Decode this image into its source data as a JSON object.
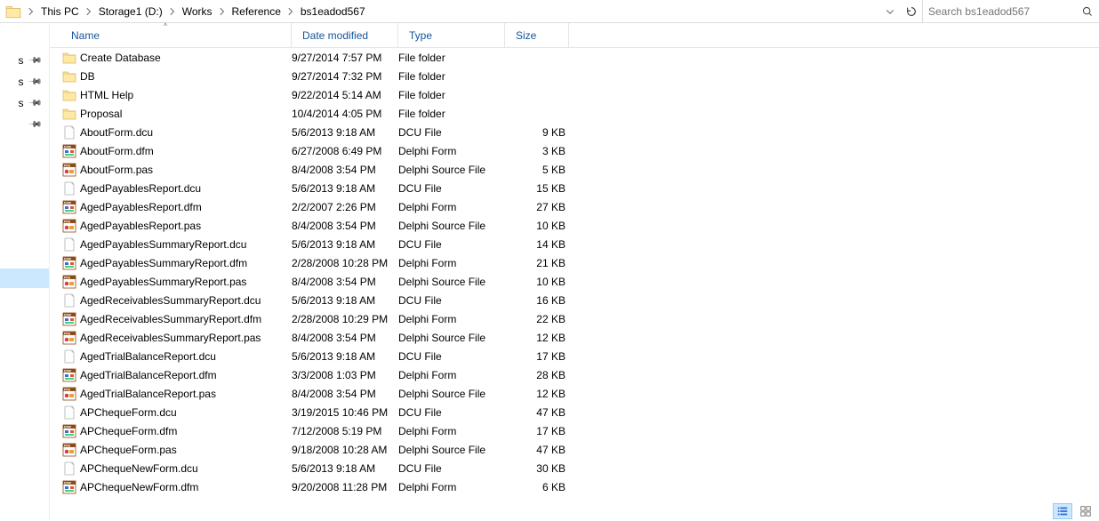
{
  "breadcrumb": {
    "segments": [
      "This PC",
      "Storage1 (D:)",
      "Works",
      "Reference",
      "bs1eadod567"
    ]
  },
  "search": {
    "placeholder": "Search bs1eadod567"
  },
  "nav_items": [
    {
      "label": "",
      "pinned": false
    },
    {
      "label": "s",
      "pinned": true
    },
    {
      "label": "s",
      "pinned": true
    },
    {
      "label": "s",
      "pinned": true
    },
    {
      "label": "",
      "pinned": true
    }
  ],
  "columns": {
    "name": "Name",
    "date": "Date modified",
    "type": "Type",
    "size": "Size",
    "sortColumn": "name",
    "sortDir": "asc"
  },
  "files": [
    {
      "icon": "folder",
      "name": "Create Database",
      "date": "9/27/2014 7:57 PM",
      "type": "File folder",
      "size": ""
    },
    {
      "icon": "folder",
      "name": "DB",
      "date": "9/27/2014 7:32 PM",
      "type": "File folder",
      "size": ""
    },
    {
      "icon": "folder",
      "name": "HTML Help",
      "date": "9/22/2014 5:14 AM",
      "type": "File folder",
      "size": ""
    },
    {
      "icon": "folder",
      "name": "Proposal",
      "date": "10/4/2014 4:05 PM",
      "type": "File folder",
      "size": ""
    },
    {
      "icon": "dcu",
      "name": "AboutForm.dcu",
      "date": "5/6/2013 9:18 AM",
      "type": "DCU File",
      "size": "9 KB"
    },
    {
      "icon": "dfm",
      "name": "AboutForm.dfm",
      "date": "6/27/2008 6:49 PM",
      "type": "Delphi Form",
      "size": "3 KB"
    },
    {
      "icon": "pas",
      "name": "AboutForm.pas",
      "date": "8/4/2008 3:54 PM",
      "type": "Delphi Source File",
      "size": "5 KB"
    },
    {
      "icon": "dcu",
      "name": "AgedPayablesReport.dcu",
      "date": "5/6/2013 9:18 AM",
      "type": "DCU File",
      "size": "15 KB"
    },
    {
      "icon": "dfm",
      "name": "AgedPayablesReport.dfm",
      "date": "2/2/2007 2:26 PM",
      "type": "Delphi Form",
      "size": "27 KB"
    },
    {
      "icon": "pas",
      "name": "AgedPayablesReport.pas",
      "date": "8/4/2008 3:54 PM",
      "type": "Delphi Source File",
      "size": "10 KB"
    },
    {
      "icon": "dcu",
      "name": "AgedPayablesSummaryReport.dcu",
      "date": "5/6/2013 9:18 AM",
      "type": "DCU File",
      "size": "14 KB"
    },
    {
      "icon": "dfm",
      "name": "AgedPayablesSummaryReport.dfm",
      "date": "2/28/2008 10:28 PM",
      "type": "Delphi Form",
      "size": "21 KB"
    },
    {
      "icon": "pas",
      "name": "AgedPayablesSummaryReport.pas",
      "date": "8/4/2008 3:54 PM",
      "type": "Delphi Source File",
      "size": "10 KB"
    },
    {
      "icon": "dcu",
      "name": "AgedReceivablesSummaryReport.dcu",
      "date": "5/6/2013 9:18 AM",
      "type": "DCU File",
      "size": "16 KB"
    },
    {
      "icon": "dfm",
      "name": "AgedReceivablesSummaryReport.dfm",
      "date": "2/28/2008 10:29 PM",
      "type": "Delphi Form",
      "size": "22 KB"
    },
    {
      "icon": "pas",
      "name": "AgedReceivablesSummaryReport.pas",
      "date": "8/4/2008 3:54 PM",
      "type": "Delphi Source File",
      "size": "12 KB"
    },
    {
      "icon": "dcu",
      "name": "AgedTrialBalanceReport.dcu",
      "date": "5/6/2013 9:18 AM",
      "type": "DCU File",
      "size": "17 KB"
    },
    {
      "icon": "dfm",
      "name": "AgedTrialBalanceReport.dfm",
      "date": "3/3/2008 1:03 PM",
      "type": "Delphi Form",
      "size": "28 KB"
    },
    {
      "icon": "pas",
      "name": "AgedTrialBalanceReport.pas",
      "date": "8/4/2008 3:54 PM",
      "type": "Delphi Source File",
      "size": "12 KB"
    },
    {
      "icon": "dcu",
      "name": "APChequeForm.dcu",
      "date": "3/19/2015 10:46 PM",
      "type": "DCU File",
      "size": "47 KB"
    },
    {
      "icon": "dfm",
      "name": "APChequeForm.dfm",
      "date": "7/12/2008 5:19 PM",
      "type": "Delphi Form",
      "size": "17 KB"
    },
    {
      "icon": "pas",
      "name": "APChequeForm.pas",
      "date": "9/18/2008 10:28 AM",
      "type": "Delphi Source File",
      "size": "47 KB"
    },
    {
      "icon": "dcu",
      "name": "APChequeNewForm.dcu",
      "date": "5/6/2013 9:18 AM",
      "type": "DCU File",
      "size": "30 KB"
    },
    {
      "icon": "dfm",
      "name": "APChequeNewForm.dfm",
      "date": "9/20/2008 11:28 PM",
      "type": "Delphi Form",
      "size": "6 KB"
    }
  ]
}
